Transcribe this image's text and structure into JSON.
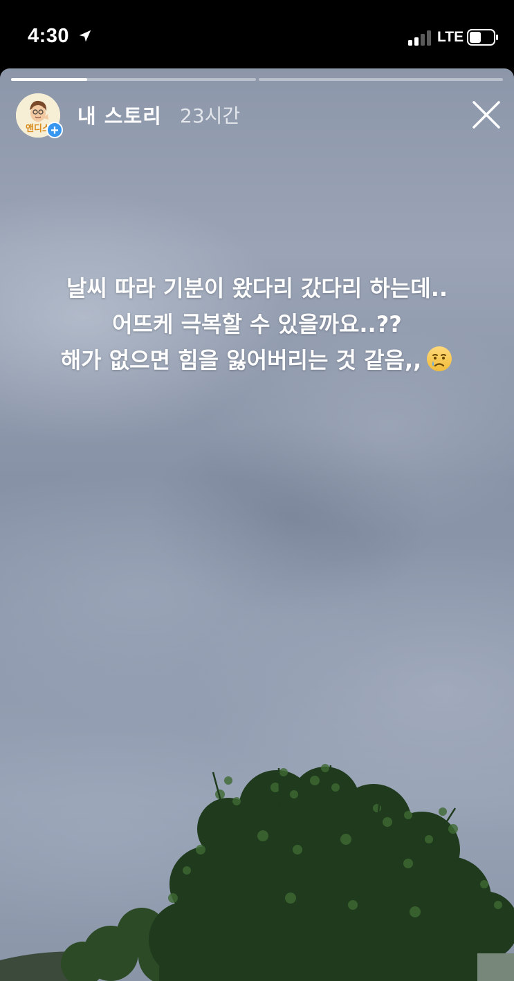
{
  "status_bar": {
    "time": "4:30",
    "network": "LTE",
    "icons": [
      "location-arrow-icon",
      "signal-bars-icon",
      "battery-icon"
    ]
  },
  "story": {
    "progress": [
      {
        "segment": 1,
        "fill": 0.31
      },
      {
        "segment": 2,
        "fill": 0
      }
    ],
    "user": {
      "name": "내 스토리",
      "time_ago": "23시간",
      "avatar_text": "앤디스",
      "badge": "+"
    },
    "caption": {
      "line1": "날씨 따라 기분이 왔다리 갔다리 하는데..",
      "line2": "어뜨케 극복할 수 있을까요..??",
      "line3": "해가 없으면 힘을 잃어버리는 것 같음,,",
      "emoji": "crying-face-icon"
    },
    "colors": {
      "sky": "#8d97aa",
      "badge": "#3797f0",
      "foliage": "#1f3a1c"
    }
  }
}
